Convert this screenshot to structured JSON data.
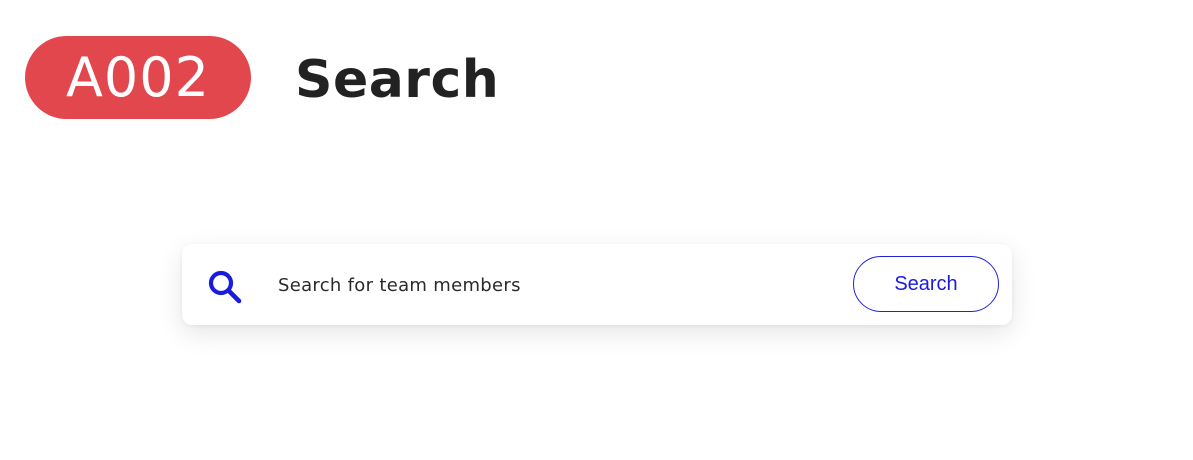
{
  "header": {
    "badge_label": "A002",
    "title": "Search"
  },
  "search": {
    "icon": "search-icon",
    "placeholder": "Search for team members",
    "value": "",
    "button_label": "Search"
  },
  "colors": {
    "badge_background": "#e1474d",
    "accent": "#1a1ae0",
    "title_text": "#222222"
  }
}
